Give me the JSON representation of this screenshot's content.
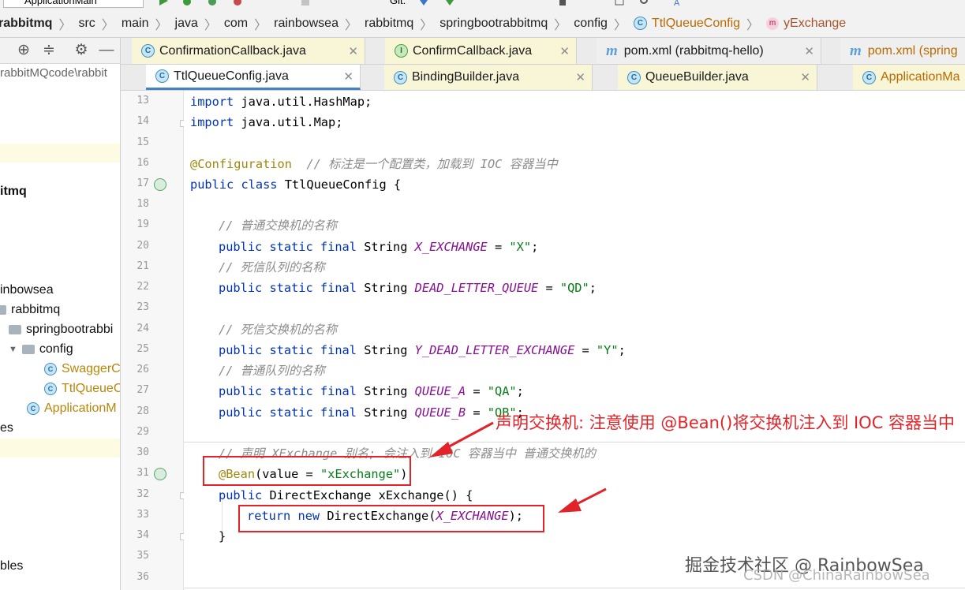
{
  "toolbar": {
    "run_config": "ApplicationMain",
    "git_label": "Git:"
  },
  "breadcrumb": [
    {
      "label": "rabbitmq",
      "kind": "module"
    },
    {
      "label": "src",
      "kind": "dir"
    },
    {
      "label": "main",
      "kind": "dir"
    },
    {
      "label": "java",
      "kind": "dir"
    },
    {
      "label": "com",
      "kind": "dir"
    },
    {
      "label": "rainbowsea",
      "kind": "dir"
    },
    {
      "label": "rabbitmq",
      "kind": "dir"
    },
    {
      "label": "springbootrabbitmq",
      "kind": "dir"
    },
    {
      "label": "config",
      "kind": "dir"
    },
    {
      "label": "TtlQueueConfig",
      "kind": "class"
    },
    {
      "label": "yExchange",
      "kind": "method"
    }
  ],
  "project": {
    "path_text": "rabbitMQcode\\rabbit",
    "tree": [
      {
        "label": "itmq",
        "style": "bold"
      },
      {
        "label": "inbowsea",
        "style": "plain"
      },
      {
        "label": "rabbitmq",
        "style": "folder"
      },
      {
        "label": "springbootrabbi",
        "style": "folder"
      },
      {
        "label": "config",
        "style": "folder-open"
      },
      {
        "label": "SwaggerC",
        "style": "class"
      },
      {
        "label": "TtlQueueC",
        "style": "class"
      },
      {
        "label": "ApplicationM",
        "style": "app"
      },
      {
        "label": "es",
        "style": "plain"
      },
      {
        "label": "bles",
        "style": "plain"
      }
    ]
  },
  "tabs_row1": [
    {
      "label": "ConfirmationCallback.java",
      "icon": "class-icon"
    },
    {
      "label": "ConfirmCallback.java",
      "icon": "interface-icon"
    },
    {
      "label": "pom.xml (rabbitmq-hello)",
      "icon": "maven-icon"
    },
    {
      "label": "pom.xml (spring",
      "icon": "maven-icon"
    }
  ],
  "tabs_row2": [
    {
      "label": "TtlQueueConfig.java",
      "icon": "class-icon",
      "active": true
    },
    {
      "label": "BindingBuilder.java",
      "icon": "class-icon"
    },
    {
      "label": "QueueBuilder.java",
      "icon": "class-icon"
    },
    {
      "label": "ApplicationMa",
      "icon": "app-icon"
    }
  ],
  "line_numbers": [
    "13",
    "14",
    "15",
    "16",
    "17",
    "18",
    "19",
    "20",
    "21",
    "22",
    "23",
    "24",
    "25",
    "26",
    "27",
    "28",
    "29",
    "30",
    "31",
    "32",
    "33",
    "34",
    "35",
    "36"
  ],
  "code": {
    "l13": "import java.util.HashMap;",
    "l14": "import java.util.Map;",
    "l16_ann": "@Configuration",
    "l16_cmt": "// 标注是一个配置类，加载到 IOC 容器当中",
    "l17_kw": "public class",
    "l17_name": " TtlQueueConfig {",
    "l19": "// 普通交换机的名称",
    "l20_kw": "public static final",
    "l20_type": " String ",
    "l20_fld": "X_EXCHANGE",
    "l20_eq": " = ",
    "l20_str": "\"X\"",
    "l21": "// 死信队列的名称",
    "l22_fld": "DEAD_LETTER_QUEUE",
    "l22_str": "\"QD\"",
    "l24": "// 死信交换机的名称",
    "l25_fld": "Y_DEAD_LETTER_EXCHANGE",
    "l25_str": "\"Y\"",
    "l26": "// 普通队列的名称",
    "l27_fld": "QUEUE_A",
    "l27_str": "\"QA\"",
    "l28_fld": "QUEUE_B",
    "l28_str": "\"QB\"",
    "l30": "// 声明 XExchange 别名; 会注入到 IOC 容器当中 普通交换机的",
    "l31_ann": "@Bean",
    "l31_rest_a": "(value = ",
    "l31_str": "\"xExchange\"",
    "l31_rest_b": ")",
    "l32_kw": "public",
    "l32_rest": " DirectExchange xExchange() {",
    "l33_kw1": "return",
    "l33_kw2": "new",
    "l33_a": " DirectExchange(",
    "l33_fld": "X_EXCHANGE",
    "l33_b": ");",
    "l34": "}",
    "semicolon": ";"
  },
  "overlay": {
    "note": "声明交换机: 注意使用 @Bean()将交换机注入到 IOC 容器当中",
    "watermark_main": "掘金技术社区 @ RainbowSea",
    "watermark_sub": "CSDN @ChinaRainbowSea",
    "accent_color": "#e0242a"
  }
}
